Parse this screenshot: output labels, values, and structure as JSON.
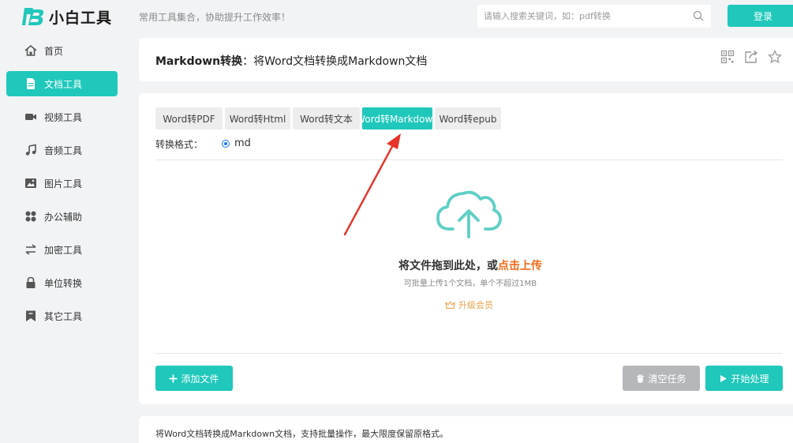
{
  "header": {
    "brand": "小白工具",
    "slogan": "常用工具集合，协助提升工作效率！",
    "search_placeholder": "请输入搜索关键词，如：pdf转换",
    "login_label": "登录"
  },
  "sidebar": {
    "items": [
      {
        "label": "首页",
        "icon": "home-icon"
      },
      {
        "label": "文档工具",
        "icon": "document-icon",
        "active": true
      },
      {
        "label": "视频工具",
        "icon": "video-icon"
      },
      {
        "label": "音频工具",
        "icon": "music-icon"
      },
      {
        "label": "图片工具",
        "icon": "image-icon"
      },
      {
        "label": "办公辅助",
        "icon": "apps-icon"
      },
      {
        "label": "加密工具",
        "icon": "swap-icon"
      },
      {
        "label": "单位转换",
        "icon": "lock-icon"
      },
      {
        "label": "其它工具",
        "icon": "bookmark-icon"
      }
    ]
  },
  "page": {
    "title_bold": "Markdown转换",
    "title_rest": "：将Word文档转换成Markdown文档"
  },
  "tabs": [
    {
      "label": "Word转PDF"
    },
    {
      "label": "Word转Html"
    },
    {
      "label": "Word转文本"
    },
    {
      "label": "Word转Markdown",
      "active": true
    },
    {
      "label": "Word转epub"
    }
  ],
  "format": {
    "label": "转换格式：",
    "value": "md"
  },
  "upload": {
    "drop_text": "将文件拖到此处，或",
    "drop_link": "点击上传",
    "limit_text": "可批量上传1个文档，单个不超过1MB",
    "upgrade_label": "升级会员"
  },
  "buttons": {
    "add_label": "添加文件",
    "clear_label": "清空任务",
    "start_label": "开始处理"
  },
  "description": "将Word文档转换成Markdown文档，支持批量操作，最大限度保留原格式。",
  "colors": {
    "accent": "#1fc8bb",
    "link": "#f06a1a",
    "upgrade": "#e8a04a",
    "arrow": "#e8322a"
  }
}
